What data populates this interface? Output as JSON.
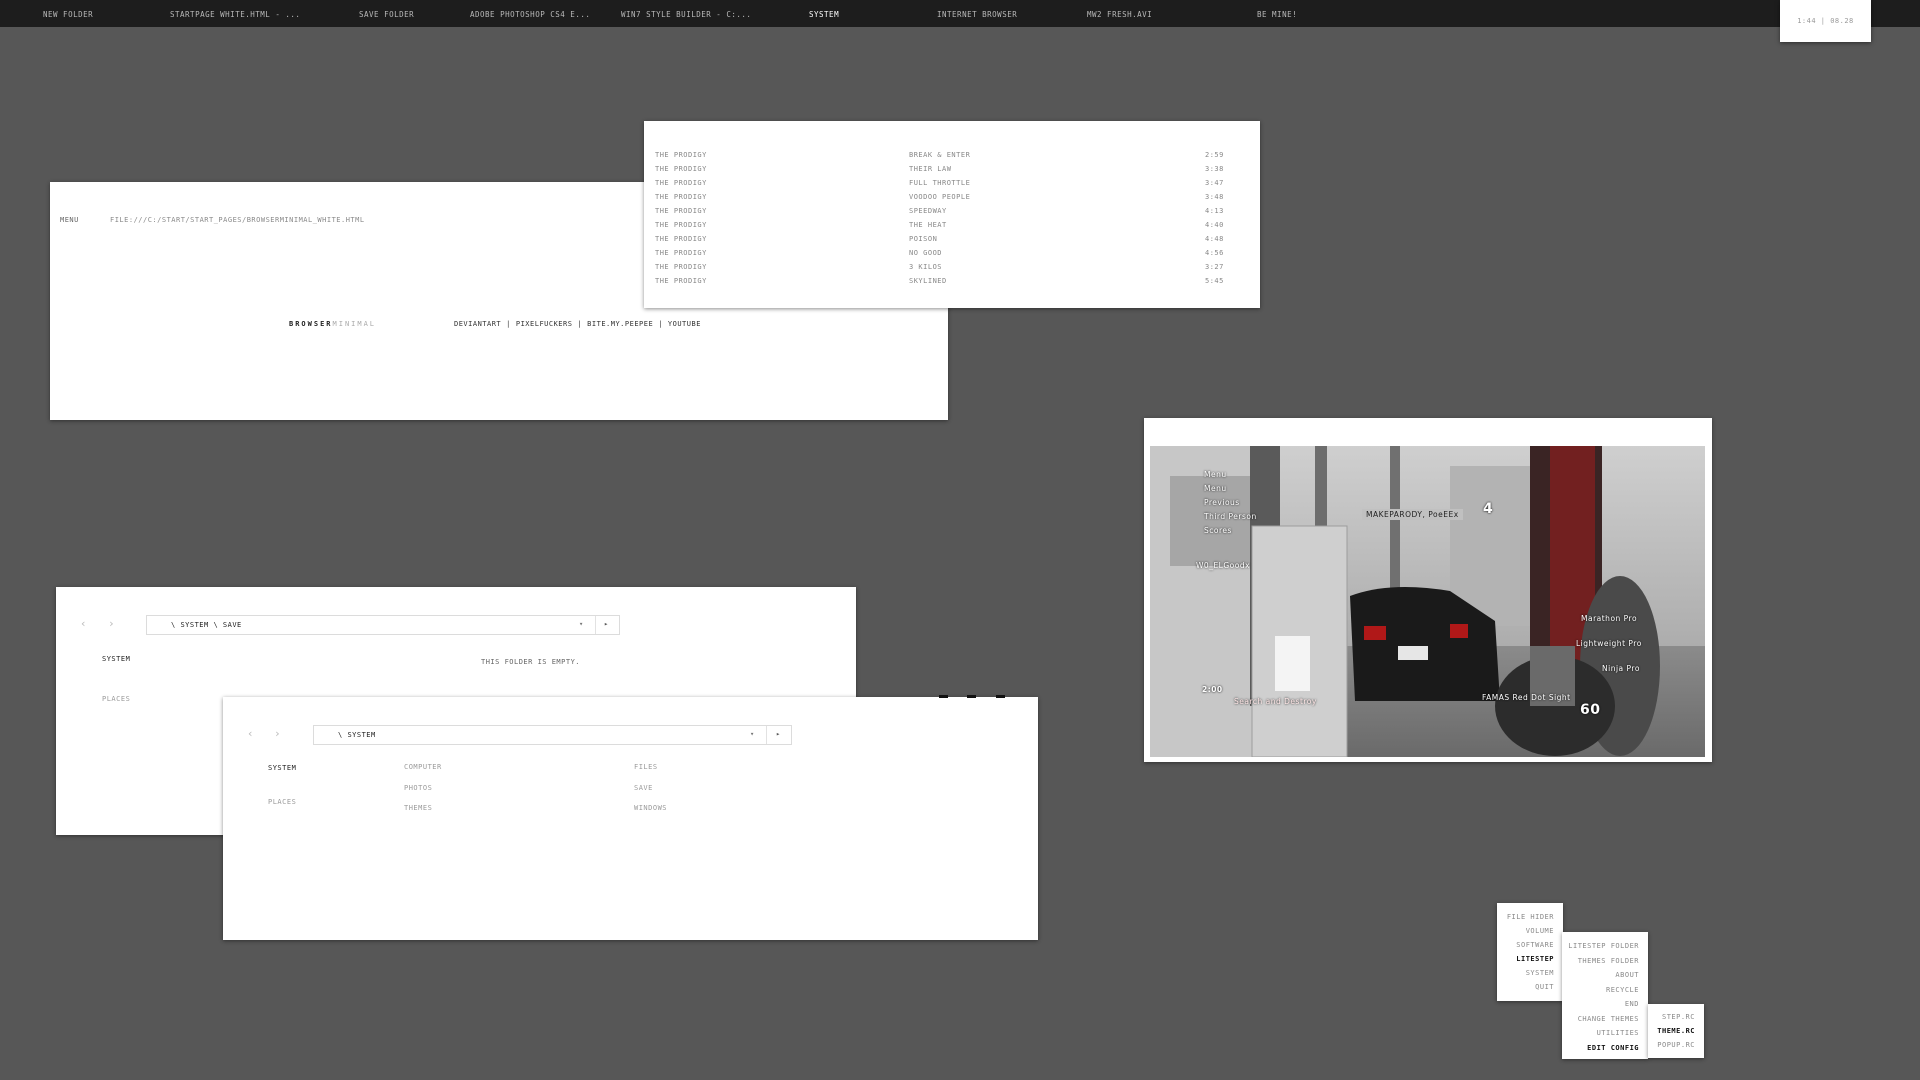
{
  "taskbar": {
    "tasks": [
      {
        "label": "New Folder"
      },
      {
        "label": "startpage white.html - ..."
      },
      {
        "label": "Save Folder"
      },
      {
        "label": "Adobe Photoshop CS4 E..."
      },
      {
        "label": "Win7 Style Builder - C:..."
      },
      {
        "label": "System"
      },
      {
        "label": "Internet Browser"
      },
      {
        "label": "MW2 FRESH.avi"
      },
      {
        "label": "Be Mine!"
      }
    ],
    "active_task": "System",
    "clock": "1:44 | 08.28"
  },
  "browser": {
    "menu_label": "MENU",
    "url": "FILE:///C:/START/START_PAGES/BROWSERMINIMAL_WHITE.HTML",
    "brand_bold": "BROWSER",
    "brand_light": "MINIMAL",
    "links": [
      "DEVIANTART",
      "PIXELFUCKERS",
      "BITE.MY.PEEPEE",
      "YOUTUBE"
    ],
    "separator": "|"
  },
  "playlist": {
    "tracks": [
      {
        "artist": "The Prodigy",
        "title": "Break & Enter",
        "duration": "2:59"
      },
      {
        "artist": "The Prodigy",
        "title": "Their Law",
        "duration": "3:38"
      },
      {
        "artist": "The Prodigy",
        "title": "Full Throttle",
        "duration": "3:47"
      },
      {
        "artist": "The Prodigy",
        "title": "Voodoo People",
        "duration": "3:48"
      },
      {
        "artist": "The Prodigy",
        "title": "Speedway",
        "duration": "4:13"
      },
      {
        "artist": "The Prodigy",
        "title": "The Heat",
        "duration": "4:40"
      },
      {
        "artist": "The Prodigy",
        "title": "Poison",
        "duration": "4:48"
      },
      {
        "artist": "The Prodigy",
        "title": "No Good",
        "duration": "4:56"
      },
      {
        "artist": "The Prodigy",
        "title": "3 Kilos",
        "duration": "3:27"
      },
      {
        "artist": "The Prodigy",
        "title": "Skylined",
        "duration": "5:45"
      }
    ]
  },
  "video": {
    "hud": {
      "menu_items": [
        "Menu",
        "Menu",
        "Previous",
        "Third Person",
        "Scores"
      ],
      "scoreboard": "MAKEPARODY, PoeEEx",
      "score_right": "4",
      "left_label": "W0_ELGoodx",
      "timer": "2:00",
      "mode": "Search and Destroy",
      "weapon": "FAMAS Red Dot Sight",
      "ammo": "60",
      "perks": [
        "Marathon Pro",
        "Lightweight Pro",
        "Ninja Pro"
      ]
    }
  },
  "explorer_back": {
    "path": [
      "SYSTEM",
      "SAVE"
    ],
    "sidebar": {
      "current": "SYSTEM",
      "places": "PLACES"
    },
    "empty_message": "THIS FOLDER IS EMPTY.",
    "nav": {
      "back": "‹",
      "forward": "›",
      "dropdown": "▾",
      "go": "▸",
      "path_sep": "\\"
    }
  },
  "explorer_front": {
    "path": [
      "SYSTEM"
    ],
    "sidebar": {
      "current": "SYSTEM",
      "places": "PLACES"
    },
    "folders": [
      "COMPUTER",
      "PHOTOS",
      "THEMES",
      "FILES",
      "SAVE",
      "WINDOWS"
    ],
    "nav": {
      "back": "‹",
      "forward": "›",
      "dropdown": "▾",
      "go": "▸",
      "path_sep": "\\"
    }
  },
  "menus": {
    "main": [
      "File Hider",
      "Volume",
      "Software",
      "LiteStep",
      "System",
      "Quit"
    ],
    "main_active": "LiteStep",
    "litestep": [
      "LiteStep Folder",
      "Themes Folder",
      "About",
      "Recycle",
      "End",
      "Change Themes",
      "Utilities",
      "Edit Config"
    ],
    "litestep_active": "Edit Config",
    "config": [
      "step.rc",
      "theme.rc",
      "popup.rc"
    ],
    "config_active": "theme.rc"
  }
}
